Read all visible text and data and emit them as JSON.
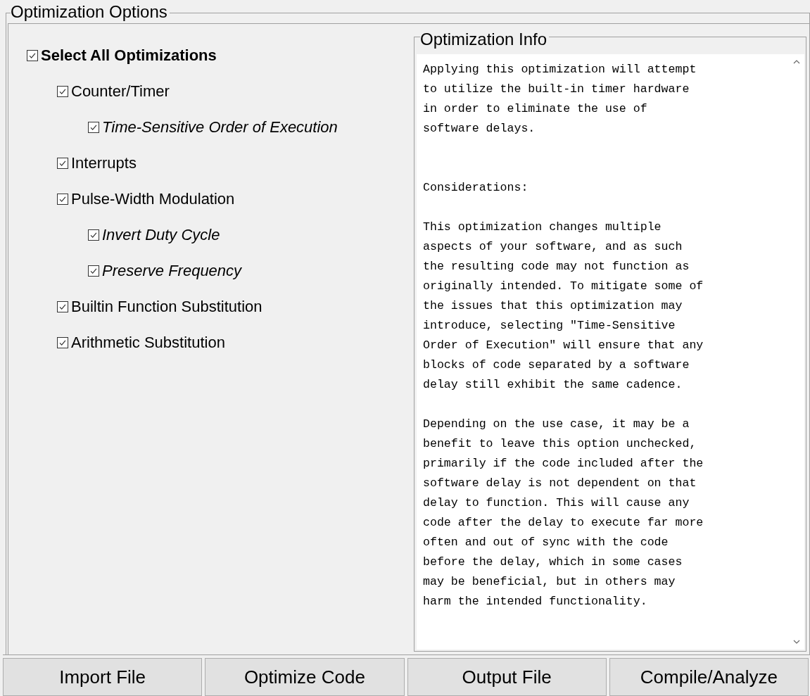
{
  "options_group": {
    "title": "Optimization Options",
    "options": [
      {
        "label": "Select All Optimizations",
        "checked": true,
        "children": [
          {
            "label": "Counter/Timer",
            "checked": true,
            "children": [
              {
                "label": "Time-Sensitive Order of Execution",
                "checked": true
              }
            ]
          },
          {
            "label": "Interrupts",
            "checked": true
          },
          {
            "label": "Pulse-Width Modulation",
            "checked": true,
            "children": [
              {
                "label": "Invert Duty Cycle",
                "checked": true
              },
              {
                "label": "Preserve Frequency",
                "checked": true
              }
            ]
          },
          {
            "label": "Builtin Function Substitution",
            "checked": true
          },
          {
            "label": "Arithmetic Substitution",
            "checked": true
          }
        ]
      }
    ],
    "info": {
      "title": "Optimization Info",
      "paragraphs": [
        [
          "Applying this optimization will attempt",
          "to utilize the built-in timer hardware",
          "in order to eliminate the use of",
          "software delays."
        ],
        [
          "Considerations:"
        ],
        [
          "This optimization changes multiple",
          "aspects of your software, and as such",
          "the resulting code may not function as",
          "originally intended. To mitigate some of",
          "the issues that this optimization may",
          "introduce, selecting \"Time-Sensitive",
          "Order of Execution\" will ensure that any",
          "blocks of code separated by a software",
          "delay still exhibit the same cadence."
        ],
        [
          "Depending on the use case, it may be a",
          "benefit to leave this option unchecked,",
          "primarily if the code included after the",
          "software delay is not dependent on that",
          "delay to function. This will cause any",
          "code after the delay to execute far more",
          "often and out of sync with the code",
          "before the delay, which in some cases",
          "may be beneficial, but in others may",
          "harm the intended functionality."
        ]
      ]
    }
  },
  "buttons": [
    {
      "label": "Import File"
    },
    {
      "label": "Optimize Code"
    },
    {
      "label": "Output File"
    },
    {
      "label": "Compile/Analyze"
    }
  ]
}
